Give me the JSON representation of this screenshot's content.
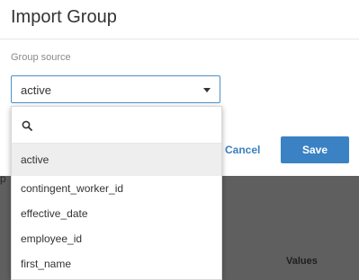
{
  "modal": {
    "title": "Import Group",
    "group_source_label": "Group source",
    "select_value": "active",
    "search_placeholder": "",
    "cancel_label": "Cancel",
    "save_label": "Save"
  },
  "dropdown": {
    "options": [
      "active",
      "contingent_worker_id",
      "effective_date",
      "employee_id",
      "first_name"
    ]
  },
  "background": {
    "edge_char": "p",
    "values_header": "Values"
  },
  "colors": {
    "accent": "#3a82c4",
    "focus_border": "#4a90c8",
    "backdrop": "#5f5f5f"
  }
}
